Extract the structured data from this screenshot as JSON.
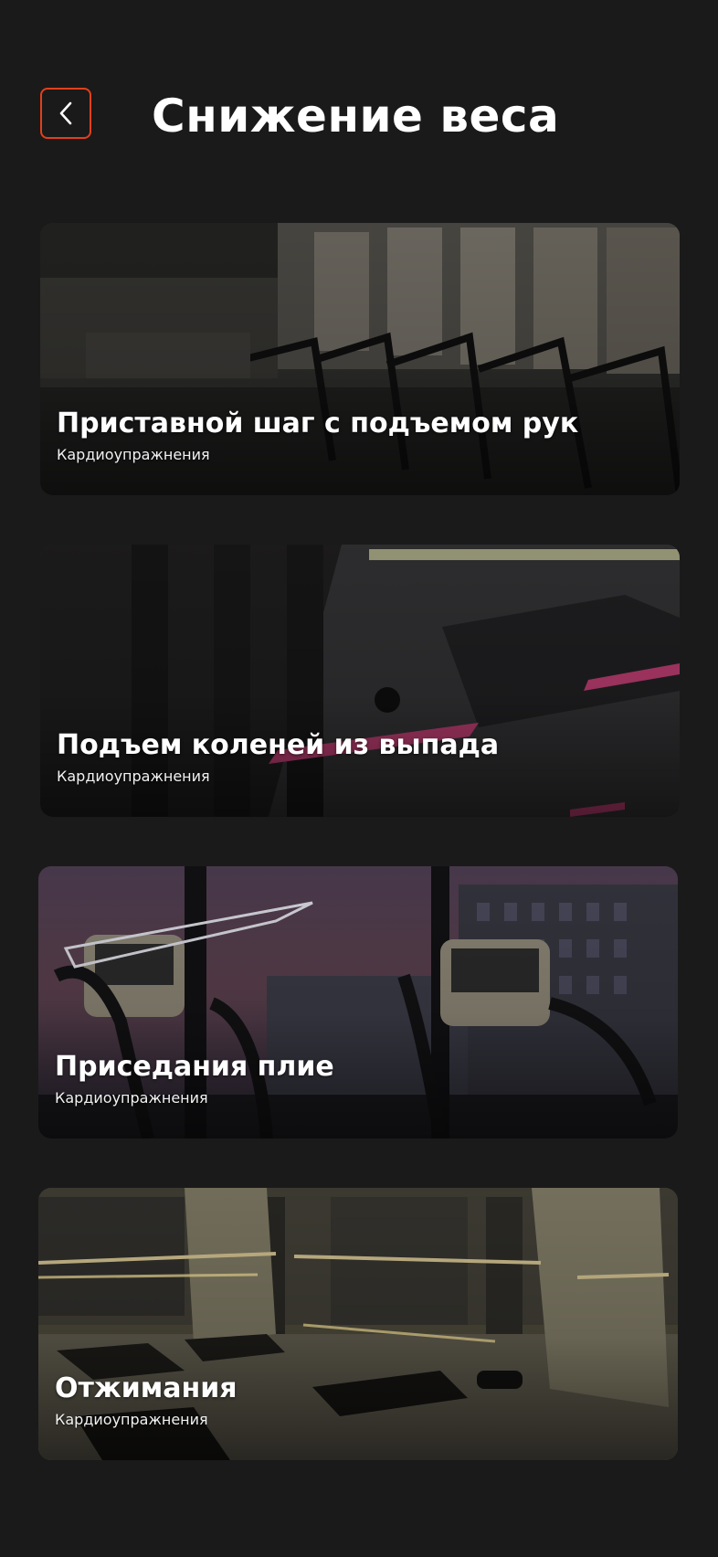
{
  "header": {
    "back_icon": "chevron-left-icon",
    "title": "Снижение веса"
  },
  "colors": {
    "background": "#1a1a1a",
    "accent": "#e2401c",
    "text": "#ffffff"
  },
  "exercises": [
    {
      "title": "Приставной шаг с подъемом рук",
      "category": "Кардиоупражнения"
    },
    {
      "title": "Подъем коленей из выпада",
      "category": "Кардиоупражнения"
    },
    {
      "title": "Приседания плие",
      "category": "Кардиоупражнения"
    },
    {
      "title": "Отжимания",
      "category": "Кардиоупражнения"
    }
  ]
}
